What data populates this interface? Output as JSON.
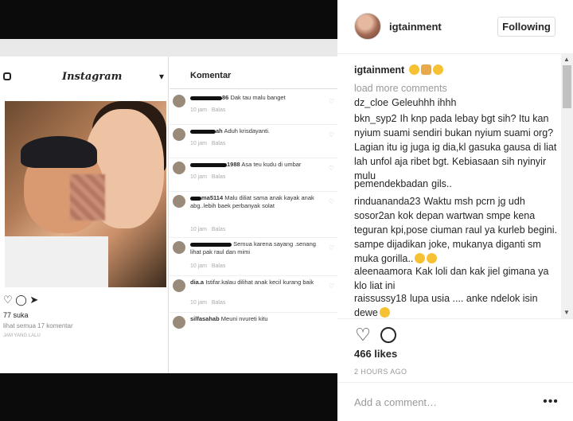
{
  "post": {
    "username": "igtainment",
    "follow_label": "Following",
    "caption_user": "igtainment",
    "load_more": "load more comments",
    "likes": "466 likes",
    "time": "2 HOURS AGO",
    "add_placeholder": "Add a comment…",
    "more_label": "•••"
  },
  "comments": [
    {
      "user": "dz_cloe",
      "text": "Geleuhhh ihhh"
    },
    {
      "user": "bkn_syp2",
      "text": "Ih knp pada lebay bgt sih? Itu kan nyium suami sendiri bukan nyium suami org? Lagian itu ig juga ig dia,kl gasuka gausa di liat lah unfol aja ribet bgt. Kebiasaan sih nyinyir mulu"
    },
    {
      "user": "pemendekbadan",
      "text": "gils.."
    },
    {
      "user": "rinduananda23",
      "text": "Waktu msh pcrn jg udh sosor2an kok depan wartwan smpe kena teguran kpi,pose ciuman raul ya kurleb begini. sampe dijadikan joke, mukanya diganti sm muka gorilla.."
    },
    {
      "user": "aleenaamora",
      "text": "Kak loli dan kak jiel gimana ya klo liat ini"
    },
    {
      "user": "raissussy18",
      "text": "lupa usia .... anke ndelok isin dewe"
    }
  ],
  "embedded": {
    "app_title": "Instagram",
    "panel_title": "Komentar",
    "likes": "77 suka",
    "see_all": "lihat semua 17 komentar",
    "time": "JAM YANG LALU",
    "comments": [
      {
        "user": "86",
        "text": "Dak tau malu banget",
        "time": "10 jam",
        "reply": "Balas"
      },
      {
        "user": "ah",
        "text": "Aduh krisdayanti.",
        "time": "10 jam",
        "reply": "Balas"
      },
      {
        "user": "1988",
        "text": "Asa teu kudu di umbar",
        "time": "10 jam",
        "reply": "Balas"
      },
      {
        "user": "ma5114",
        "text": "Malu diliat sama anak kayak anak abg..lebih baek perbanyak solat",
        "time": "10 jam",
        "reply": "Balas"
      },
      {
        "user": "",
        "text": "Semua karena sayang .senang lihat pak raul dan mimi",
        "time": "10 jam",
        "reply": "Balas"
      },
      {
        "user": "dia.a",
        "text": "Istifar.kalau dilihat anak kecil kurang baik",
        "time": "10 jam",
        "reply": "Balas"
      },
      {
        "user": "silfasahab",
        "text": "Meuni nvureti kitu",
        "time": "",
        "reply": ""
      }
    ]
  }
}
